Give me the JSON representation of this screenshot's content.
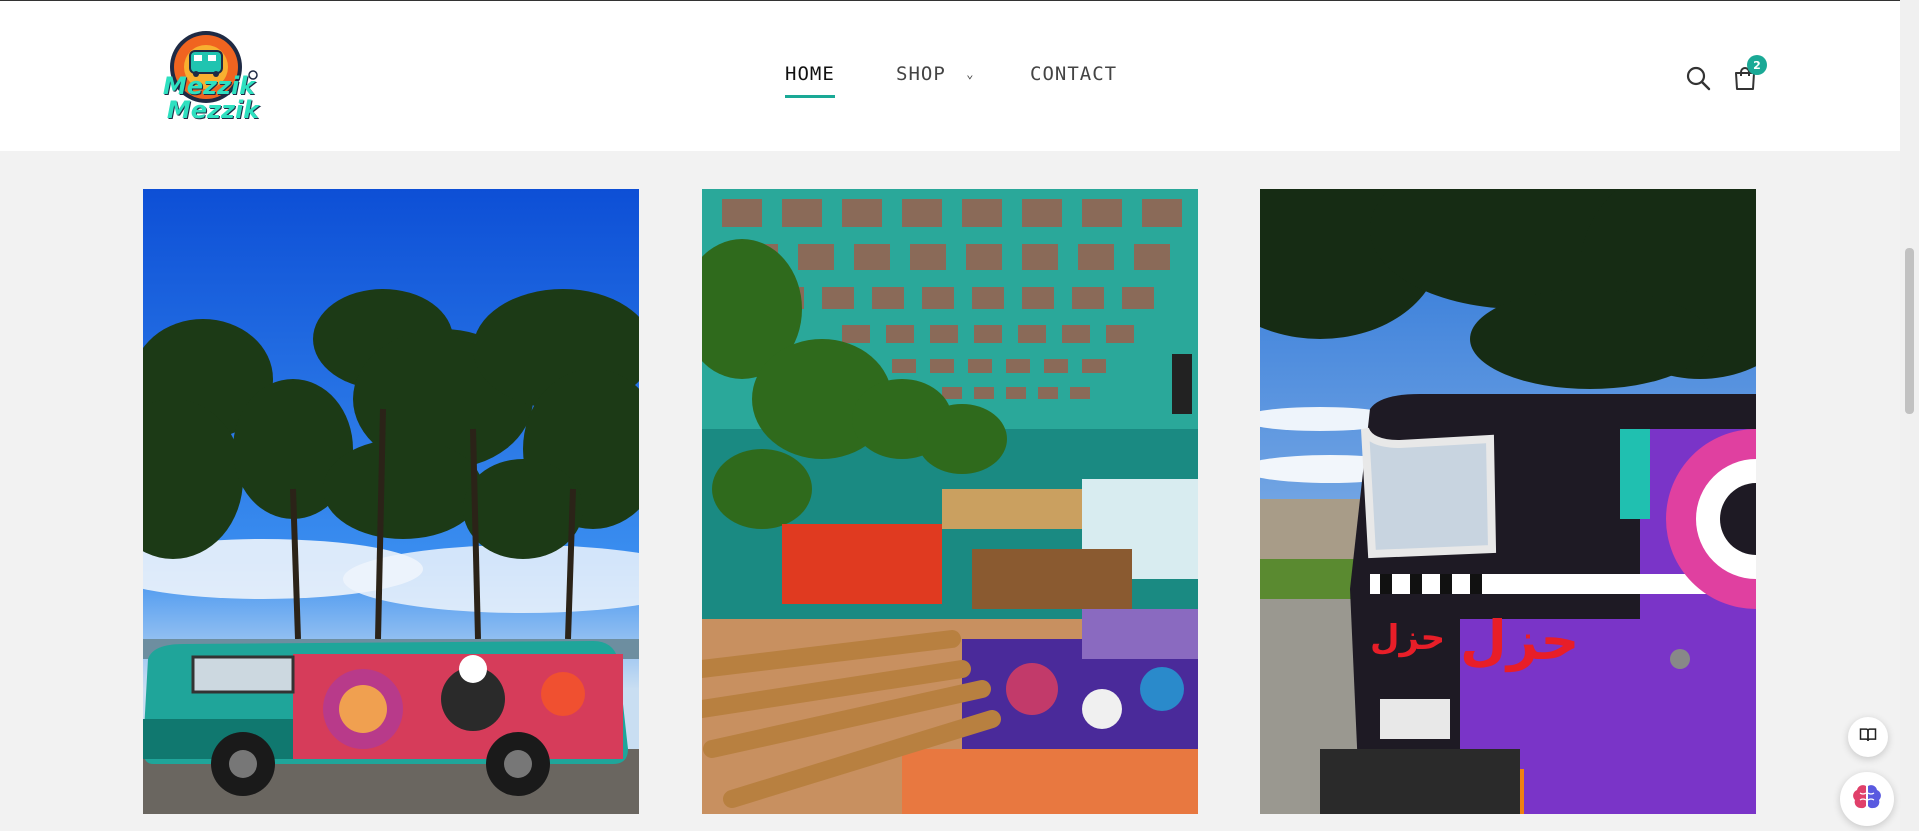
{
  "colors": {
    "accent": "#1aa996",
    "header_bg": "#ffffff",
    "page_bg": "#f2f2f2"
  },
  "logo": {
    "alt": "Mezzik Mezzik logo",
    "line1": "Mezzik",
    "line2": "Mezzik"
  },
  "nav": [
    {
      "label": "HOME",
      "active": true
    },
    {
      "label": "SHOP",
      "has_dropdown": true
    },
    {
      "label": "CONTACT"
    }
  ],
  "header_icons": {
    "search": "search-icon",
    "cart": "shopping-bag-icon",
    "cart_count": "2"
  },
  "gallery": [
    {
      "name": "painted-van-under-pines"
    },
    {
      "name": "van-interior-photo-ceiling"
    },
    {
      "name": "purple-van-rear-arabic-text",
      "text": "حزل"
    }
  ],
  "floating": {
    "reader": "book-reader-icon",
    "assistant": "brain-icon"
  }
}
